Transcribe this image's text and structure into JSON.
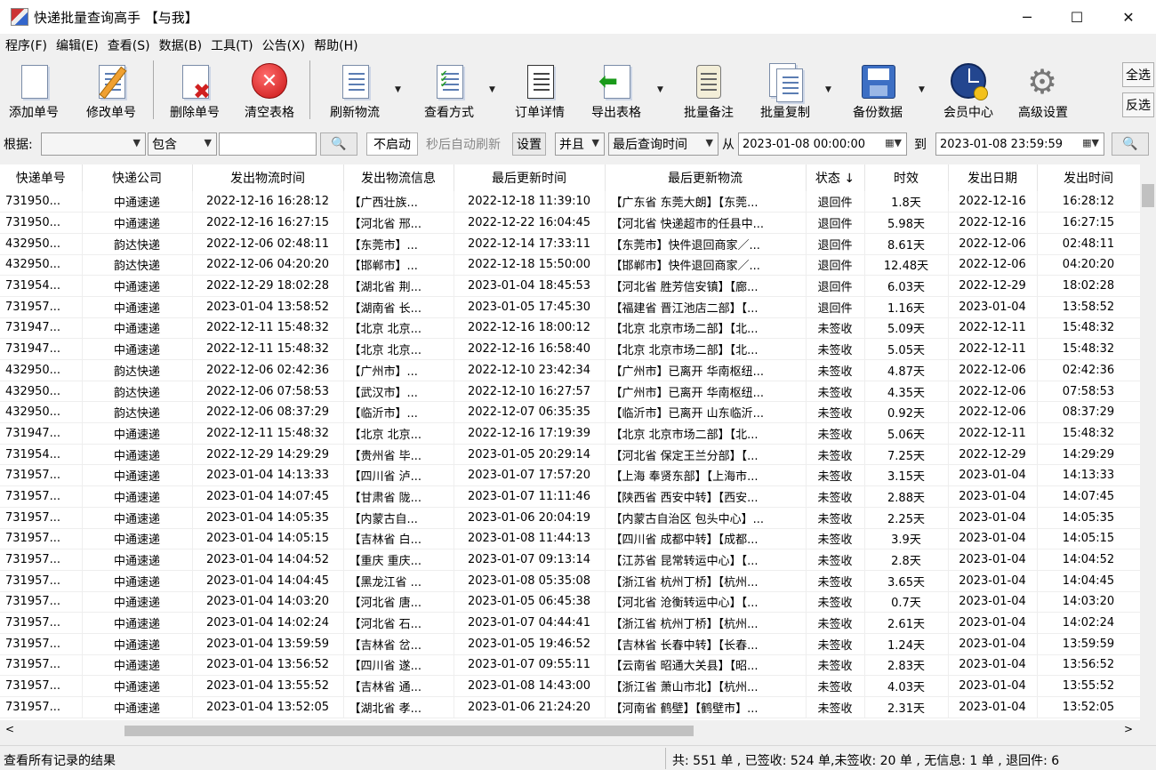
{
  "window": {
    "title": "快递批量查询高手 【与我】"
  },
  "menu": [
    "程序(F)",
    "编辑(E)",
    "查看(S)",
    "数据(B)",
    "工具(T)",
    "公告(X)",
    "帮助(H)"
  ],
  "toolbar": {
    "add": "添加单号",
    "edit": "修改单号",
    "delete": "删除单号",
    "clear": "清空表格",
    "refresh": "刷新物流",
    "view": "查看方式",
    "order": "订单详情",
    "export": "导出表格",
    "note": "批量备注",
    "copy": "批量复制",
    "backup": "备份数据",
    "member": "会员中心",
    "advanced": "高级设置",
    "select_all": "全选",
    "invert": "反选"
  },
  "filter": {
    "by_label": "根据:",
    "by_value": "",
    "op_value": "包含",
    "keyword": "",
    "auto_value": "不启动",
    "auto_text": "秒后自动刷新",
    "set_btn": "设置",
    "logic_value": "并且",
    "time_field": "最后查询时间",
    "from_label": "从",
    "from_value": "2023-01-08 00:00:00",
    "to_label": "到",
    "to_value": "2023-01-08 23:59:59"
  },
  "table": {
    "columns": [
      "快递单号",
      "快递公司",
      "发出物流时间",
      "发出物流信息",
      "最后更新时间",
      "最后更新物流",
      "状态 ↓",
      "时效",
      "发出日期",
      "发出时间"
    ],
    "rows": [
      [
        "731950...",
        "中通速递",
        "2022-12-16 16:28:12",
        "【广西壮族...",
        "2022-12-18 11:39:10",
        "【广东省 东莞大朗】【东莞...",
        "退回件",
        "1.8天",
        "2022-12-16",
        "16:28:12"
      ],
      [
        "731950...",
        "中通速递",
        "2022-12-16 16:27:15",
        "【河北省 邢...",
        "2022-12-22 16:04:45",
        "【河北省 快递超市的任县中...",
        "退回件",
        "5.98天",
        "2022-12-16",
        "16:27:15"
      ],
      [
        "432950...",
        "韵达快递",
        "2022-12-06 02:48:11",
        "【东莞市】...",
        "2022-12-14 17:33:11",
        "【东莞市】快件退回商家／...",
        "退回件",
        "8.61天",
        "2022-12-06",
        "02:48:11"
      ],
      [
        "432950...",
        "韵达快递",
        "2022-12-06 04:20:20",
        "【邯郸市】...",
        "2022-12-18 15:50:00",
        "【邯郸市】快件退回商家／...",
        "退回件",
        "12.48天",
        "2022-12-06",
        "04:20:20"
      ],
      [
        "731954...",
        "中通速递",
        "2022-12-29 18:02:28",
        "【湖北省 荆...",
        "2023-01-04 18:45:53",
        "【河北省 胜芳信安镇】【廊...",
        "退回件",
        "6.03天",
        "2022-12-29",
        "18:02:28"
      ],
      [
        "731957...",
        "中通速递",
        "2023-01-04 13:58:52",
        "【湖南省 长...",
        "2023-01-05 17:45:30",
        "【福建省 晋江池店二部】【...",
        "退回件",
        "1.16天",
        "2023-01-04",
        "13:58:52"
      ],
      [
        "731947...",
        "中通速递",
        "2022-12-11 15:48:32",
        "【北京 北京...",
        "2022-12-16 18:00:12",
        "【北京 北京市场二部】【北...",
        "未签收",
        "5.09天",
        "2022-12-11",
        "15:48:32"
      ],
      [
        "731947...",
        "中通速递",
        "2022-12-11 15:48:32",
        "【北京 北京...",
        "2022-12-16 16:58:40",
        "【北京 北京市场二部】【北...",
        "未签收",
        "5.05天",
        "2022-12-11",
        "15:48:32"
      ],
      [
        "432950...",
        "韵达快递",
        "2022-12-06 02:42:36",
        "【广州市】...",
        "2022-12-10 23:42:34",
        "【广州市】已离开 华南枢纽...",
        "未签收",
        "4.87天",
        "2022-12-06",
        "02:42:36"
      ],
      [
        "432950...",
        "韵达快递",
        "2022-12-06 07:58:53",
        "【武汉市】...",
        "2022-12-10 16:27:57",
        "【广州市】已离开 华南枢纽...",
        "未签收",
        "4.35天",
        "2022-12-06",
        "07:58:53"
      ],
      [
        "432950...",
        "韵达快递",
        "2022-12-06 08:37:29",
        "【临沂市】...",
        "2022-12-07 06:35:35",
        "【临沂市】已离开 山东临沂...",
        "未签收",
        "0.92天",
        "2022-12-06",
        "08:37:29"
      ],
      [
        "731947...",
        "中通速递",
        "2022-12-11 15:48:32",
        "【北京 北京...",
        "2022-12-16 17:19:39",
        "【北京 北京市场二部】【北...",
        "未签收",
        "5.06天",
        "2022-12-11",
        "15:48:32"
      ],
      [
        "731954...",
        "中通速递",
        "2022-12-29 14:29:29",
        "【贵州省 毕...",
        "2023-01-05 20:29:14",
        "【河北省 保定王兰分部】【...",
        "未签收",
        "7.25天",
        "2022-12-29",
        "14:29:29"
      ],
      [
        "731957...",
        "中通速递",
        "2023-01-04 14:13:33",
        "【四川省 泸...",
        "2023-01-07 17:57:20",
        "【上海 奉贤东部】【上海市...",
        "未签收",
        "3.15天",
        "2023-01-04",
        "14:13:33"
      ],
      [
        "731957...",
        "中通速递",
        "2023-01-04 14:07:45",
        "【甘肃省 陇...",
        "2023-01-07 11:11:46",
        "【陕西省 西安中转】【西安...",
        "未签收",
        "2.88天",
        "2023-01-04",
        "14:07:45"
      ],
      [
        "731957...",
        "中通速递",
        "2023-01-04 14:05:35",
        "【内蒙古自...",
        "2023-01-06 20:04:19",
        "【内蒙古自治区 包头中心】...",
        "未签收",
        "2.25天",
        "2023-01-04",
        "14:05:35"
      ],
      [
        "731957...",
        "中通速递",
        "2023-01-04 14:05:15",
        "【吉林省 白...",
        "2023-01-08 11:44:13",
        "【四川省 成都中转】【成都...",
        "未签收",
        "3.9天",
        "2023-01-04",
        "14:05:15"
      ],
      [
        "731957...",
        "中通速递",
        "2023-01-04 14:04:52",
        "【重庆 重庆...",
        "2023-01-07 09:13:14",
        "【江苏省 昆常转运中心】【...",
        "未签收",
        "2.8天",
        "2023-01-04",
        "14:04:52"
      ],
      [
        "731957...",
        "中通速递",
        "2023-01-04 14:04:45",
        "【黑龙江省 ...",
        "2023-01-08 05:35:08",
        "【浙江省 杭州丁桥】【杭州...",
        "未签收",
        "3.65天",
        "2023-01-04",
        "14:04:45"
      ],
      [
        "731957...",
        "中通速递",
        "2023-01-04 14:03:20",
        "【河北省 唐...",
        "2023-01-05 06:45:38",
        "【河北省 沧衡转运中心】【...",
        "未签收",
        "0.7天",
        "2023-01-04",
        "14:03:20"
      ],
      [
        "731957...",
        "中通速递",
        "2023-01-04 14:02:24",
        "【河北省 石...",
        "2023-01-07 04:44:41",
        "【浙江省 杭州丁桥】【杭州...",
        "未签收",
        "2.61天",
        "2023-01-04",
        "14:02:24"
      ],
      [
        "731957...",
        "中通速递",
        "2023-01-04 13:59:59",
        "【吉林省 岔...",
        "2023-01-05 19:46:52",
        "【吉林省 长春中转】【长春...",
        "未签收",
        "1.24天",
        "2023-01-04",
        "13:59:59"
      ],
      [
        "731957...",
        "中通速递",
        "2023-01-04 13:56:52",
        "【四川省 遂...",
        "2023-01-07 09:55:11",
        "【云南省 昭通大关县】【昭...",
        "未签收",
        "2.83天",
        "2023-01-04",
        "13:56:52"
      ],
      [
        "731957...",
        "中通速递",
        "2023-01-04 13:55:52",
        "【吉林省 通...",
        "2023-01-08 14:43:00",
        "【浙江省 萧山市北】【杭州...",
        "未签收",
        "4.03天",
        "2023-01-04",
        "13:55:52"
      ],
      [
        "731957...",
        "中通速递",
        "2023-01-04 13:52:05",
        "【湖北省 孝...",
        "2023-01-06 21:24:20",
        "【河南省 鹤壁】【鹤壁市】...",
        "未签收",
        "2.31天",
        "2023-01-04",
        "13:52:05"
      ]
    ]
  },
  "status": {
    "left": "查看所有记录的结果",
    "right": "共: 551 单 , 已签收: 524 单,未签收: 20 单 , 无信息: 1 单 , 退回件: 6"
  }
}
